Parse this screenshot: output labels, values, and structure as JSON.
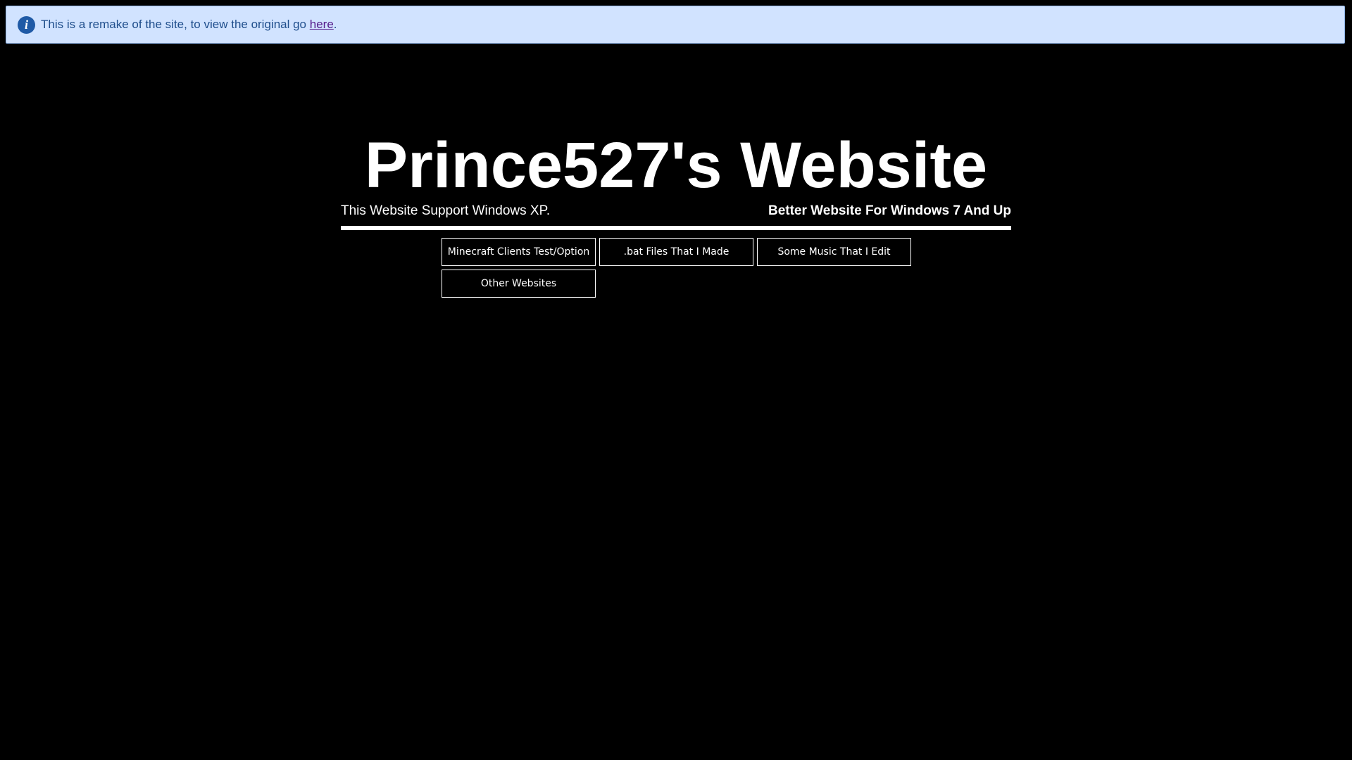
{
  "notice": {
    "icon": "info-icon",
    "text_before": "This is a remake of the site, to view the original go ",
    "link_label": "here",
    "text_after": ".",
    "background_color": "#d1e3ff",
    "text_color": "#1f4e8c"
  },
  "header": {
    "title": "Prince527's Website",
    "subtitle_left": "This Website Support Windows XP.",
    "subtitle_right": "Better Website For Windows 7 And Up"
  },
  "nav": {
    "buttons": [
      {
        "label": "Minecraft Clients Test/Option"
      },
      {
        "label": ".bat Files That I Made"
      },
      {
        "label": "Some Music That I Edit"
      },
      {
        "label": "Other Websites"
      }
    ]
  }
}
